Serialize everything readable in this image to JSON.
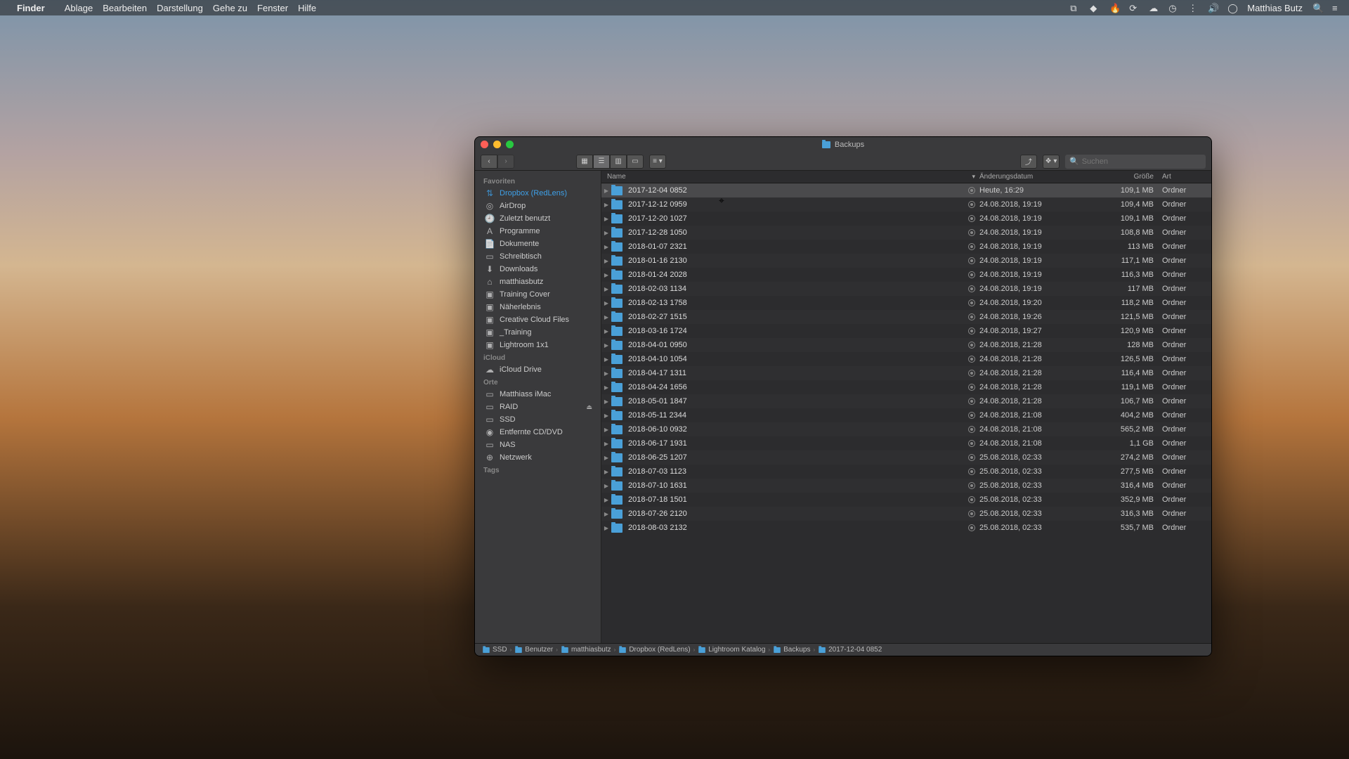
{
  "menubar": {
    "app": "Finder",
    "items": [
      "Ablage",
      "Bearbeiten",
      "Darstellung",
      "Gehe zu",
      "Fenster",
      "Hilfe"
    ],
    "user": "Matthias Butz"
  },
  "window": {
    "title": "Backups",
    "search_placeholder": "Suchen"
  },
  "sidebar": {
    "sections": [
      {
        "header": "Favoriten",
        "items": [
          {
            "icon": "⇅",
            "label": "Dropbox (RedLens)",
            "sel": true
          },
          {
            "icon": "◎",
            "label": "AirDrop"
          },
          {
            "icon": "🕘",
            "label": "Zuletzt benutzt"
          },
          {
            "icon": "A",
            "label": "Programme"
          },
          {
            "icon": "📄",
            "label": "Dokumente"
          },
          {
            "icon": "▭",
            "label": "Schreibtisch"
          },
          {
            "icon": "⬇",
            "label": "Downloads"
          },
          {
            "icon": "⌂",
            "label": "matthiasbutz"
          },
          {
            "icon": "▣",
            "label": "Training Cover"
          },
          {
            "icon": "▣",
            "label": "Näherlebnis"
          },
          {
            "icon": "▣",
            "label": "Creative Cloud Files"
          },
          {
            "icon": "▣",
            "label": "_Training"
          },
          {
            "icon": "▣",
            "label": "Lightroom 1x1"
          }
        ]
      },
      {
        "header": "iCloud",
        "items": [
          {
            "icon": "☁",
            "label": "iCloud Drive"
          }
        ]
      },
      {
        "header": "Orte",
        "items": [
          {
            "icon": "▭",
            "label": "Matthiass iMac"
          },
          {
            "icon": "▭",
            "label": "RAID",
            "eject": true
          },
          {
            "icon": "▭",
            "label": "SSD"
          },
          {
            "icon": "◉",
            "label": "Entfernte CD/DVD"
          },
          {
            "icon": "▭",
            "label": "NAS"
          },
          {
            "icon": "⊕",
            "label": "Netzwerk"
          }
        ]
      },
      {
        "header": "Tags",
        "items": []
      }
    ]
  },
  "columns": {
    "name": "Name",
    "date": "Änderungsdatum",
    "size": "Größe",
    "kind": "Art"
  },
  "rows": [
    {
      "name": "2017-12-04 0852",
      "date": "Heute, 16:29",
      "size": "109,1 MB",
      "kind": "Ordner",
      "sel": true
    },
    {
      "name": "2017-12-12 0959",
      "date": "24.08.2018, 19:19",
      "size": "109,4 MB",
      "kind": "Ordner"
    },
    {
      "name": "2017-12-20 1027",
      "date": "24.08.2018, 19:19",
      "size": "109,1 MB",
      "kind": "Ordner"
    },
    {
      "name": "2017-12-28 1050",
      "date": "24.08.2018, 19:19",
      "size": "108,8 MB",
      "kind": "Ordner"
    },
    {
      "name": "2018-01-07 2321",
      "date": "24.08.2018, 19:19",
      "size": "113 MB",
      "kind": "Ordner"
    },
    {
      "name": "2018-01-16 2130",
      "date": "24.08.2018, 19:19",
      "size": "117,1 MB",
      "kind": "Ordner"
    },
    {
      "name": "2018-01-24 2028",
      "date": "24.08.2018, 19:19",
      "size": "116,3 MB",
      "kind": "Ordner"
    },
    {
      "name": "2018-02-03 1134",
      "date": "24.08.2018, 19:19",
      "size": "117 MB",
      "kind": "Ordner"
    },
    {
      "name": "2018-02-13 1758",
      "date": "24.08.2018, 19:20",
      "size": "118,2 MB",
      "kind": "Ordner"
    },
    {
      "name": "2018-02-27 1515",
      "date": "24.08.2018, 19:26",
      "size": "121,5 MB",
      "kind": "Ordner"
    },
    {
      "name": "2018-03-16 1724",
      "date": "24.08.2018, 19:27",
      "size": "120,9 MB",
      "kind": "Ordner"
    },
    {
      "name": "2018-04-01 0950",
      "date": "24.08.2018, 21:28",
      "size": "128 MB",
      "kind": "Ordner"
    },
    {
      "name": "2018-04-10 1054",
      "date": "24.08.2018, 21:28",
      "size": "126,5 MB",
      "kind": "Ordner"
    },
    {
      "name": "2018-04-17 1311",
      "date": "24.08.2018, 21:28",
      "size": "116,4 MB",
      "kind": "Ordner"
    },
    {
      "name": "2018-04-24 1656",
      "date": "24.08.2018, 21:28",
      "size": "119,1 MB",
      "kind": "Ordner"
    },
    {
      "name": "2018-05-01 1847",
      "date": "24.08.2018, 21:28",
      "size": "106,7 MB",
      "kind": "Ordner"
    },
    {
      "name": "2018-05-11 2344",
      "date": "24.08.2018, 21:08",
      "size": "404,2 MB",
      "kind": "Ordner"
    },
    {
      "name": "2018-06-10 0932",
      "date": "24.08.2018, 21:08",
      "size": "565,2 MB",
      "kind": "Ordner"
    },
    {
      "name": "2018-06-17 1931",
      "date": "24.08.2018, 21:08",
      "size": "1,1 GB",
      "kind": "Ordner"
    },
    {
      "name": "2018-06-25 1207",
      "date": "25.08.2018, 02:33",
      "size": "274,2 MB",
      "kind": "Ordner"
    },
    {
      "name": "2018-07-03 1123",
      "date": "25.08.2018, 02:33",
      "size": "277,5 MB",
      "kind": "Ordner"
    },
    {
      "name": "2018-07-10 1631",
      "date": "25.08.2018, 02:33",
      "size": "316,4 MB",
      "kind": "Ordner"
    },
    {
      "name": "2018-07-18 1501",
      "date": "25.08.2018, 02:33",
      "size": "352,9 MB",
      "kind": "Ordner"
    },
    {
      "name": "2018-07-26 2120",
      "date": "25.08.2018, 02:33",
      "size": "316,3 MB",
      "kind": "Ordner"
    },
    {
      "name": "2018-08-03 2132",
      "date": "25.08.2018, 02:33",
      "size": "535,7 MB",
      "kind": "Ordner"
    }
  ],
  "path": [
    "SSD",
    "Benutzer",
    "matthiasbutz",
    "Dropbox (RedLens)",
    "Lightroom Katalog",
    "Backups",
    "2017-12-04 0852"
  ]
}
